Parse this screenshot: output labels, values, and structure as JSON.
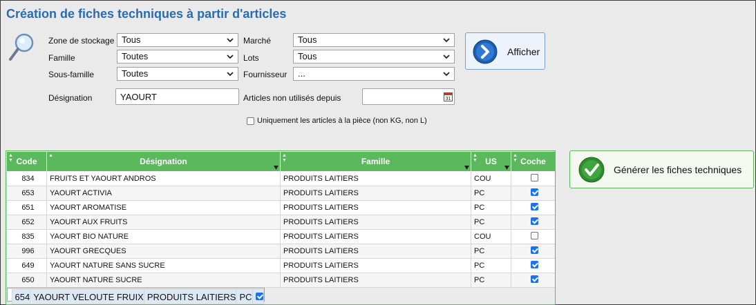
{
  "page": {
    "title": "Création de fiches techniques à partir d'articles"
  },
  "filters": {
    "zone_label": "Zone de stockage",
    "zone_value": "Tous",
    "famille_label": "Famille",
    "famille_value": "Toutes",
    "sousfamille_label": "Sous-famille",
    "sousfamille_value": "Toutes",
    "marche_label": "Marché",
    "marche_value": "Tous",
    "lots_label": "Lots",
    "lots_value": "Tous",
    "fournisseur_label": "Fournisseur",
    "fournisseur_value": "...",
    "designation_label": "Désignation",
    "designation_value": "YAOURT",
    "non_utilises_label": "Articles non utilisés depuis",
    "non_utilises_value": "",
    "piece_label": "Uniquement les articles à la pièce (non KG, non L)",
    "piece_checked": false
  },
  "buttons": {
    "afficher": "Afficher",
    "generer": "Générer les fiches techniques"
  },
  "table": {
    "headers": {
      "code": "Code",
      "designation": "Désignation",
      "famille": "Famille",
      "us": "US",
      "coche": "Coche"
    },
    "rows": [
      {
        "code": "834",
        "designation": "FRUITS ET YAOURT ANDROS",
        "famille": "PRODUITS LAITIERS",
        "us": "COU",
        "checked": false
      },
      {
        "code": "653",
        "designation": "YAOURT ACTIVIA",
        "famille": "PRODUITS LAITIERS",
        "us": "PC",
        "checked": true
      },
      {
        "code": "651",
        "designation": "YAOURT AROMATISE",
        "famille": "PRODUITS LAITIERS",
        "us": "PC",
        "checked": true
      },
      {
        "code": "652",
        "designation": "YAOURT AUX FRUITS",
        "famille": "PRODUITS LAITIERS",
        "us": "PC",
        "checked": true
      },
      {
        "code": "835",
        "designation": "YAOURT BIO NATURE",
        "famille": "PRODUITS LAITIERS",
        "us": "COU",
        "checked": false
      },
      {
        "code": "996",
        "designation": "YAOURT GRECQUES",
        "famille": "PRODUITS LAITIERS",
        "us": "PC",
        "checked": true
      },
      {
        "code": "649",
        "designation": "YAOURT NATURE SANS SUCRE",
        "famille": "PRODUITS LAITIERS",
        "us": "PC",
        "checked": true
      },
      {
        "code": "650",
        "designation": "YAOURT NATURE SUCRE",
        "famille": "PRODUITS LAITIERS",
        "us": "PC",
        "checked": true
      },
      {
        "code": "654",
        "designation": "YAOURT VELOUTE FRUIX",
        "famille": "PRODUITS LAITIERS",
        "us": "PC",
        "checked": true
      }
    ]
  },
  "colors": {
    "title": "#2b6cb0",
    "grid_header": "#5cb85c",
    "checkbox_on": "#1a73e8"
  },
  "icons": {
    "search": "magnifier-icon",
    "show": "arrow-right-circle-icon",
    "generate": "check-circle-icon",
    "calendar": "calendar-icon"
  }
}
